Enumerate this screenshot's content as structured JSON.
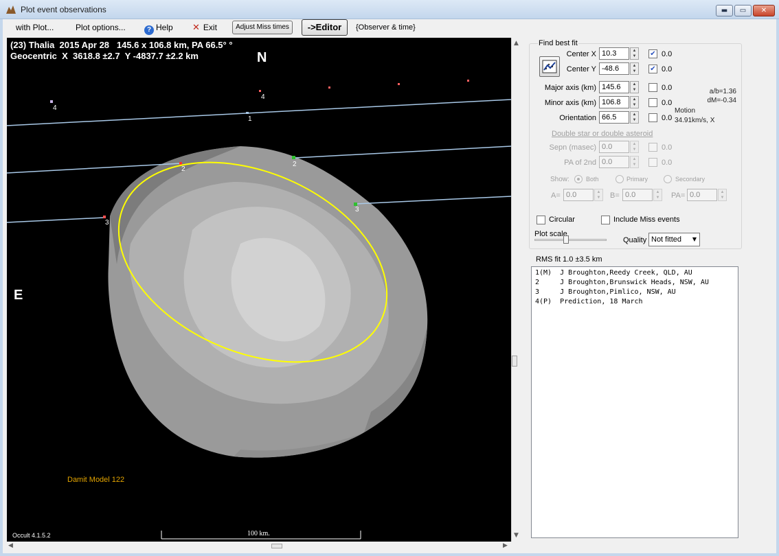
{
  "window": {
    "title": "Plot event observations",
    "min_glyph": "▬",
    "max_glyph": "▭",
    "close_glyph": "✕"
  },
  "menu": {
    "with_plot": "with Plot...",
    "plot_options": "Plot options...",
    "help": "Help",
    "help_glyph": "?",
    "exit": "Exit",
    "exit_glyph": "✕",
    "adjust_miss": "Adjust Miss times",
    "editor": "->Editor",
    "observer_time": "{Observer & time}"
  },
  "plot": {
    "header_line1": "(23) Thalia  2015 Apr 28   145.6 x 106.8 km, PA 66.5° °",
    "header_line2": "Geocentric  X  3618.8 ±2.7  Y -4837.7 ±2.2 km",
    "north": "N",
    "east": "E",
    "model": "Damit Model 122",
    "version": "Occult 4.1.5.2",
    "scale": "100 km.",
    "chord_labels": [
      "1",
      "2",
      "2",
      "3",
      "3",
      "4",
      "4"
    ],
    "colors": {
      "background": "#000000",
      "chord": "#a9c9e8",
      "limb": "#ffff00",
      "shape_fill": "#9c9c9c",
      "model_label": "#e3a400"
    }
  },
  "panel": {
    "find_best_fit": "Find best fit",
    "fit_icon": "fit-chart-icon",
    "params": [
      {
        "label": "Center X",
        "value": "10.3",
        "checked": true,
        "extra": "0.0"
      },
      {
        "label": "Center Y",
        "value": "-48.6",
        "checked": true,
        "extra": "0.0"
      },
      {
        "label": "Major axis (km)",
        "value": "145.6",
        "checked": false,
        "extra": "0.0"
      },
      {
        "label": "Minor axis (km)",
        "value": "106.8",
        "checked": false,
        "extra": "0.0"
      },
      {
        "label": "Orientation",
        "value": "66.5",
        "checked": false,
        "extra": "0.0"
      }
    ],
    "ratio": "a/b=1.36",
    "dm": "dM=-0.34",
    "motion_label": "Motion",
    "motion_value": "34.91km/s, X",
    "double_star": "Double star  or  double asteroid",
    "sepn_label": "Sepn (masec)",
    "sepn_value": "0.0",
    "sepn_extra": "0.0",
    "pa2_label": "PA of 2nd",
    "pa2_value": "0.0",
    "pa2_extra": "0.0",
    "show_label": "Show:",
    "show_both": "Both",
    "show_primary": "Primary",
    "show_secondary": "Secondary",
    "a_label": "A=",
    "a_value": "0.0",
    "b_label": "B=",
    "b_value": "0.0",
    "pa_label": "PA=",
    "pa_value": "0.0",
    "circular": "Circular",
    "include_miss": "Include Miss events",
    "plot_scale": "Plot scale",
    "quality_label": "Quality",
    "quality_value": "Not fitted",
    "rms_fit": "RMS fit  1.0 ±3.5 km",
    "list": [
      "1(M)  J Broughton,Reedy Creek, QLD, AU",
      "2     J Broughton,Brunswick Heads, NSW, AU",
      "3     J Broughton,Pimlico, NSW, AU",
      "4(P)  Prediction, 18 March"
    ]
  }
}
